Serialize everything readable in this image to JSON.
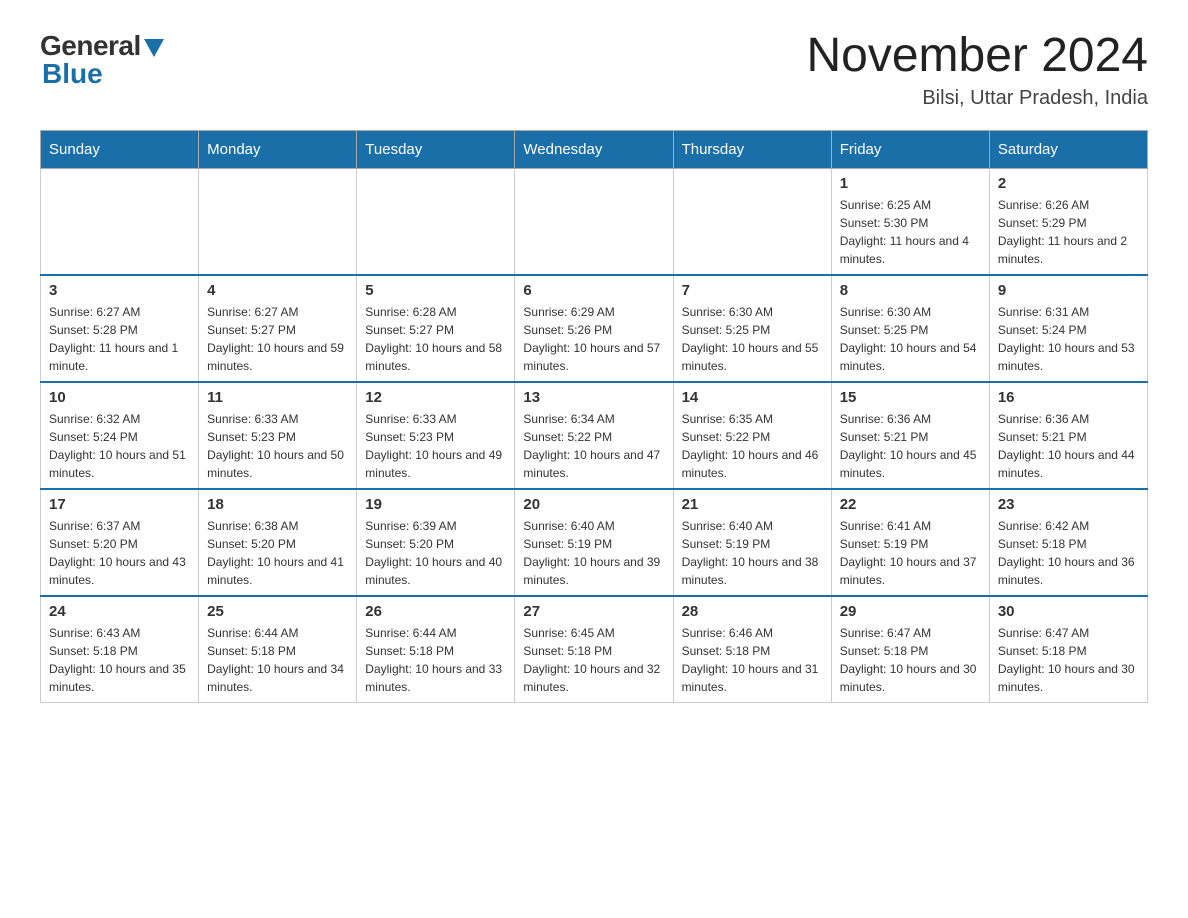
{
  "header": {
    "logo_general": "General",
    "logo_blue": "Blue",
    "month_year": "November 2024",
    "location": "Bilsi, Uttar Pradesh, India"
  },
  "days_of_week": [
    "Sunday",
    "Monday",
    "Tuesday",
    "Wednesday",
    "Thursday",
    "Friday",
    "Saturday"
  ],
  "weeks": [
    [
      {
        "day": "",
        "sunrise": "",
        "sunset": "",
        "daylight": ""
      },
      {
        "day": "",
        "sunrise": "",
        "sunset": "",
        "daylight": ""
      },
      {
        "day": "",
        "sunrise": "",
        "sunset": "",
        "daylight": ""
      },
      {
        "day": "",
        "sunrise": "",
        "sunset": "",
        "daylight": ""
      },
      {
        "day": "",
        "sunrise": "",
        "sunset": "",
        "daylight": ""
      },
      {
        "day": "1",
        "sunrise": "Sunrise: 6:25 AM",
        "sunset": "Sunset: 5:30 PM",
        "daylight": "Daylight: 11 hours and 4 minutes."
      },
      {
        "day": "2",
        "sunrise": "Sunrise: 6:26 AM",
        "sunset": "Sunset: 5:29 PM",
        "daylight": "Daylight: 11 hours and 2 minutes."
      }
    ],
    [
      {
        "day": "3",
        "sunrise": "Sunrise: 6:27 AM",
        "sunset": "Sunset: 5:28 PM",
        "daylight": "Daylight: 11 hours and 1 minute."
      },
      {
        "day": "4",
        "sunrise": "Sunrise: 6:27 AM",
        "sunset": "Sunset: 5:27 PM",
        "daylight": "Daylight: 10 hours and 59 minutes."
      },
      {
        "day": "5",
        "sunrise": "Sunrise: 6:28 AM",
        "sunset": "Sunset: 5:27 PM",
        "daylight": "Daylight: 10 hours and 58 minutes."
      },
      {
        "day": "6",
        "sunrise": "Sunrise: 6:29 AM",
        "sunset": "Sunset: 5:26 PM",
        "daylight": "Daylight: 10 hours and 57 minutes."
      },
      {
        "day": "7",
        "sunrise": "Sunrise: 6:30 AM",
        "sunset": "Sunset: 5:25 PM",
        "daylight": "Daylight: 10 hours and 55 minutes."
      },
      {
        "day": "8",
        "sunrise": "Sunrise: 6:30 AM",
        "sunset": "Sunset: 5:25 PM",
        "daylight": "Daylight: 10 hours and 54 minutes."
      },
      {
        "day": "9",
        "sunrise": "Sunrise: 6:31 AM",
        "sunset": "Sunset: 5:24 PM",
        "daylight": "Daylight: 10 hours and 53 minutes."
      }
    ],
    [
      {
        "day": "10",
        "sunrise": "Sunrise: 6:32 AM",
        "sunset": "Sunset: 5:24 PM",
        "daylight": "Daylight: 10 hours and 51 minutes."
      },
      {
        "day": "11",
        "sunrise": "Sunrise: 6:33 AM",
        "sunset": "Sunset: 5:23 PM",
        "daylight": "Daylight: 10 hours and 50 minutes."
      },
      {
        "day": "12",
        "sunrise": "Sunrise: 6:33 AM",
        "sunset": "Sunset: 5:23 PM",
        "daylight": "Daylight: 10 hours and 49 minutes."
      },
      {
        "day": "13",
        "sunrise": "Sunrise: 6:34 AM",
        "sunset": "Sunset: 5:22 PM",
        "daylight": "Daylight: 10 hours and 47 minutes."
      },
      {
        "day": "14",
        "sunrise": "Sunrise: 6:35 AM",
        "sunset": "Sunset: 5:22 PM",
        "daylight": "Daylight: 10 hours and 46 minutes."
      },
      {
        "day": "15",
        "sunrise": "Sunrise: 6:36 AM",
        "sunset": "Sunset: 5:21 PM",
        "daylight": "Daylight: 10 hours and 45 minutes."
      },
      {
        "day": "16",
        "sunrise": "Sunrise: 6:36 AM",
        "sunset": "Sunset: 5:21 PM",
        "daylight": "Daylight: 10 hours and 44 minutes."
      }
    ],
    [
      {
        "day": "17",
        "sunrise": "Sunrise: 6:37 AM",
        "sunset": "Sunset: 5:20 PM",
        "daylight": "Daylight: 10 hours and 43 minutes."
      },
      {
        "day": "18",
        "sunrise": "Sunrise: 6:38 AM",
        "sunset": "Sunset: 5:20 PM",
        "daylight": "Daylight: 10 hours and 41 minutes."
      },
      {
        "day": "19",
        "sunrise": "Sunrise: 6:39 AM",
        "sunset": "Sunset: 5:20 PM",
        "daylight": "Daylight: 10 hours and 40 minutes."
      },
      {
        "day": "20",
        "sunrise": "Sunrise: 6:40 AM",
        "sunset": "Sunset: 5:19 PM",
        "daylight": "Daylight: 10 hours and 39 minutes."
      },
      {
        "day": "21",
        "sunrise": "Sunrise: 6:40 AM",
        "sunset": "Sunset: 5:19 PM",
        "daylight": "Daylight: 10 hours and 38 minutes."
      },
      {
        "day": "22",
        "sunrise": "Sunrise: 6:41 AM",
        "sunset": "Sunset: 5:19 PM",
        "daylight": "Daylight: 10 hours and 37 minutes."
      },
      {
        "day": "23",
        "sunrise": "Sunrise: 6:42 AM",
        "sunset": "Sunset: 5:18 PM",
        "daylight": "Daylight: 10 hours and 36 minutes."
      }
    ],
    [
      {
        "day": "24",
        "sunrise": "Sunrise: 6:43 AM",
        "sunset": "Sunset: 5:18 PM",
        "daylight": "Daylight: 10 hours and 35 minutes."
      },
      {
        "day": "25",
        "sunrise": "Sunrise: 6:44 AM",
        "sunset": "Sunset: 5:18 PM",
        "daylight": "Daylight: 10 hours and 34 minutes."
      },
      {
        "day": "26",
        "sunrise": "Sunrise: 6:44 AM",
        "sunset": "Sunset: 5:18 PM",
        "daylight": "Daylight: 10 hours and 33 minutes."
      },
      {
        "day": "27",
        "sunrise": "Sunrise: 6:45 AM",
        "sunset": "Sunset: 5:18 PM",
        "daylight": "Daylight: 10 hours and 32 minutes."
      },
      {
        "day": "28",
        "sunrise": "Sunrise: 6:46 AM",
        "sunset": "Sunset: 5:18 PM",
        "daylight": "Daylight: 10 hours and 31 minutes."
      },
      {
        "day": "29",
        "sunrise": "Sunrise: 6:47 AM",
        "sunset": "Sunset: 5:18 PM",
        "daylight": "Daylight: 10 hours and 30 minutes."
      },
      {
        "day": "30",
        "sunrise": "Sunrise: 6:47 AM",
        "sunset": "Sunset: 5:18 PM",
        "daylight": "Daylight: 10 hours and 30 minutes."
      }
    ]
  ]
}
